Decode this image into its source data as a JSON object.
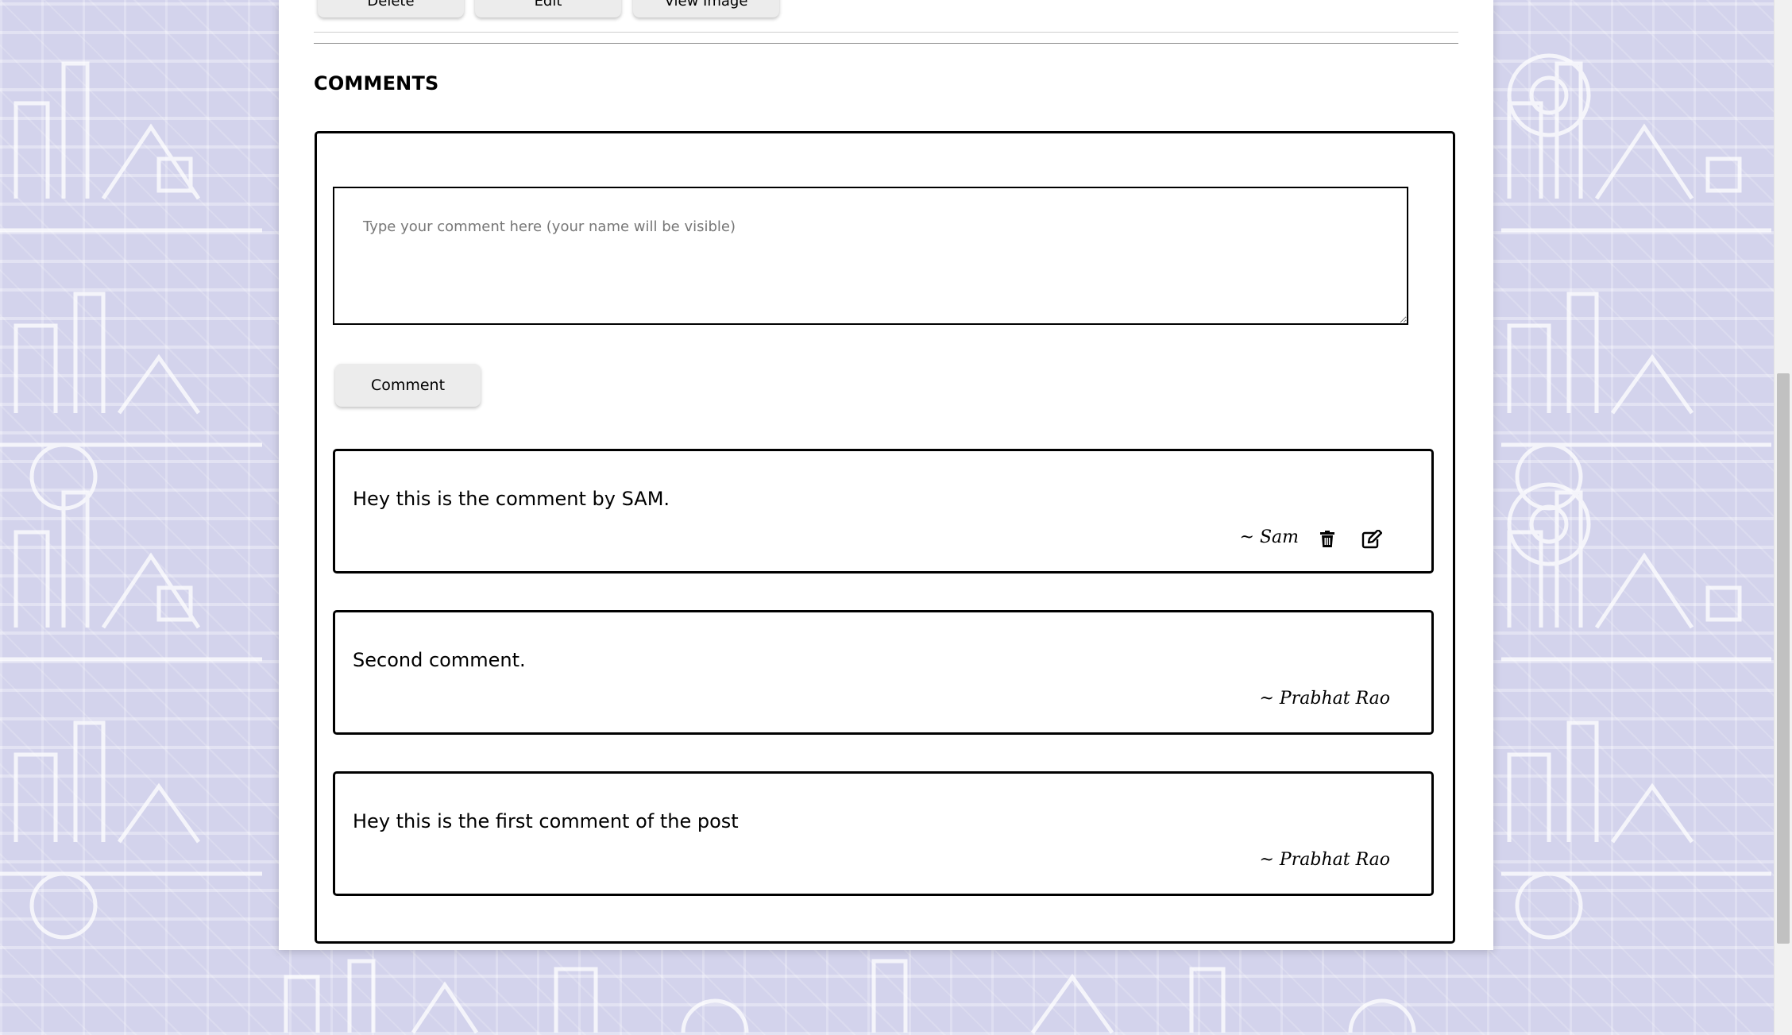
{
  "toolbar": {
    "delete_label": "Delete",
    "edit_label": "Edit",
    "view_image_label": "View Image"
  },
  "comments_section": {
    "title": "COMMENTS",
    "input_placeholder": "Type your comment here (your name will be visible)",
    "submit_label": "Comment",
    "items": [
      {
        "text": "Hey this is the comment by SAM.",
        "author": "~ Sam",
        "editable": true
      },
      {
        "text": "Second comment.",
        "author": "~ Prabhat Rao",
        "editable": false
      },
      {
        "text": "Hey this is the first comment of the post",
        "author": "~ Prabhat Rao",
        "editable": false
      }
    ]
  },
  "icons": {
    "delete": "trash-icon",
    "edit": "edit-icon"
  },
  "colors": {
    "background": "#d3d3ec",
    "card": "#ffffff",
    "button": "#ececec",
    "border": "#000000"
  }
}
